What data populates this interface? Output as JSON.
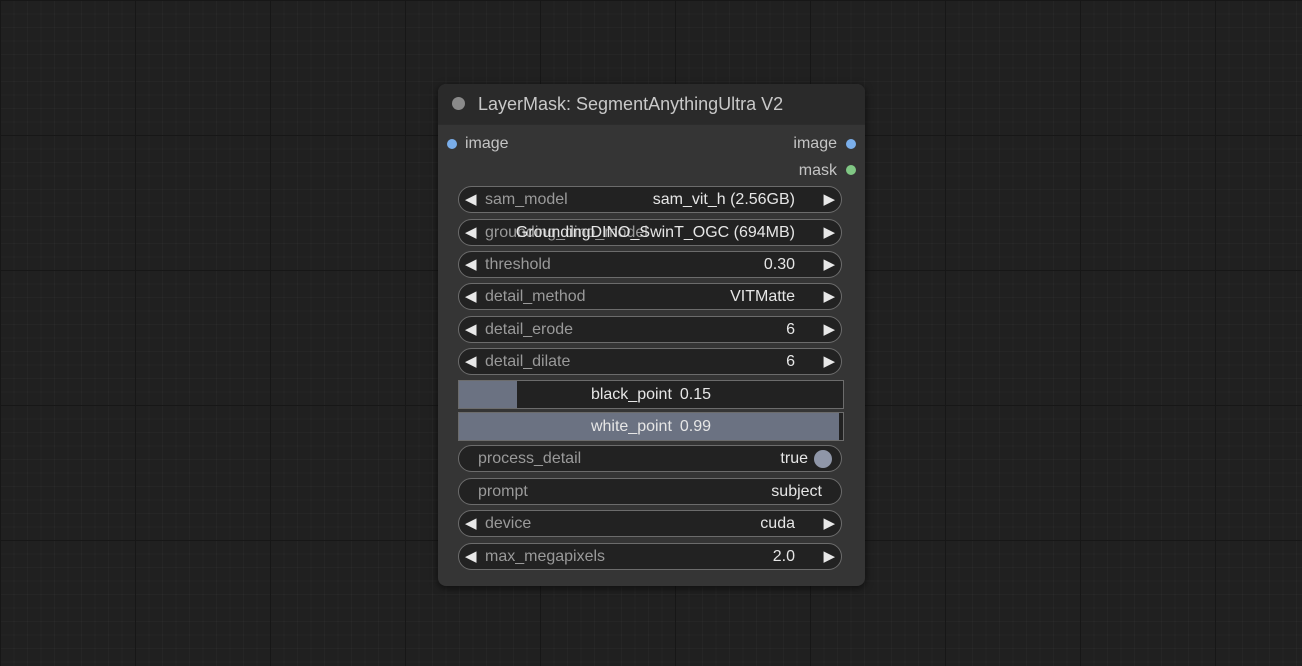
{
  "node": {
    "title": "LayerMask: SegmentAnythingUltra V2",
    "inputs": [
      {
        "label": "image",
        "color": "#7aaeea"
      }
    ],
    "outputs": [
      {
        "label": "image",
        "color": "#7aaeea"
      },
      {
        "label": "mask",
        "color": "#80c784"
      }
    ],
    "widgets": {
      "sam_model": {
        "label": "sam_model",
        "value": "sam_vit_h (2.56GB)"
      },
      "grounding_dino_model": {
        "label": "grounding_dino_model",
        "value": "GroundingDINO_SwinT_OGC (694MB)"
      },
      "threshold": {
        "label": "threshold",
        "value": "0.30"
      },
      "detail_method": {
        "label": "detail_method",
        "value": "VITMatte"
      },
      "detail_erode": {
        "label": "detail_erode",
        "value": "6"
      },
      "detail_dilate": {
        "label": "detail_dilate",
        "value": "6"
      },
      "black_point": {
        "label": "black_point",
        "value": "0.15",
        "fraction": 0.15
      },
      "white_point": {
        "label": "white_point",
        "value": "0.99",
        "fraction": 0.99
      },
      "process_detail": {
        "label": "process_detail",
        "value": "true"
      },
      "prompt": {
        "label": "prompt",
        "value": "subject"
      },
      "device": {
        "label": "device",
        "value": "cuda"
      },
      "max_megapixels": {
        "label": "max_megapixels",
        "value": "2.0"
      }
    }
  },
  "icons": {
    "decrement": "left-triangle-icon",
    "increment": "right-triangle-icon",
    "toggle": "toggle-knob-icon"
  },
  "colors": {
    "background": "#202020",
    "node_body": "#353535",
    "slider_fill": "#6b7282"
  }
}
